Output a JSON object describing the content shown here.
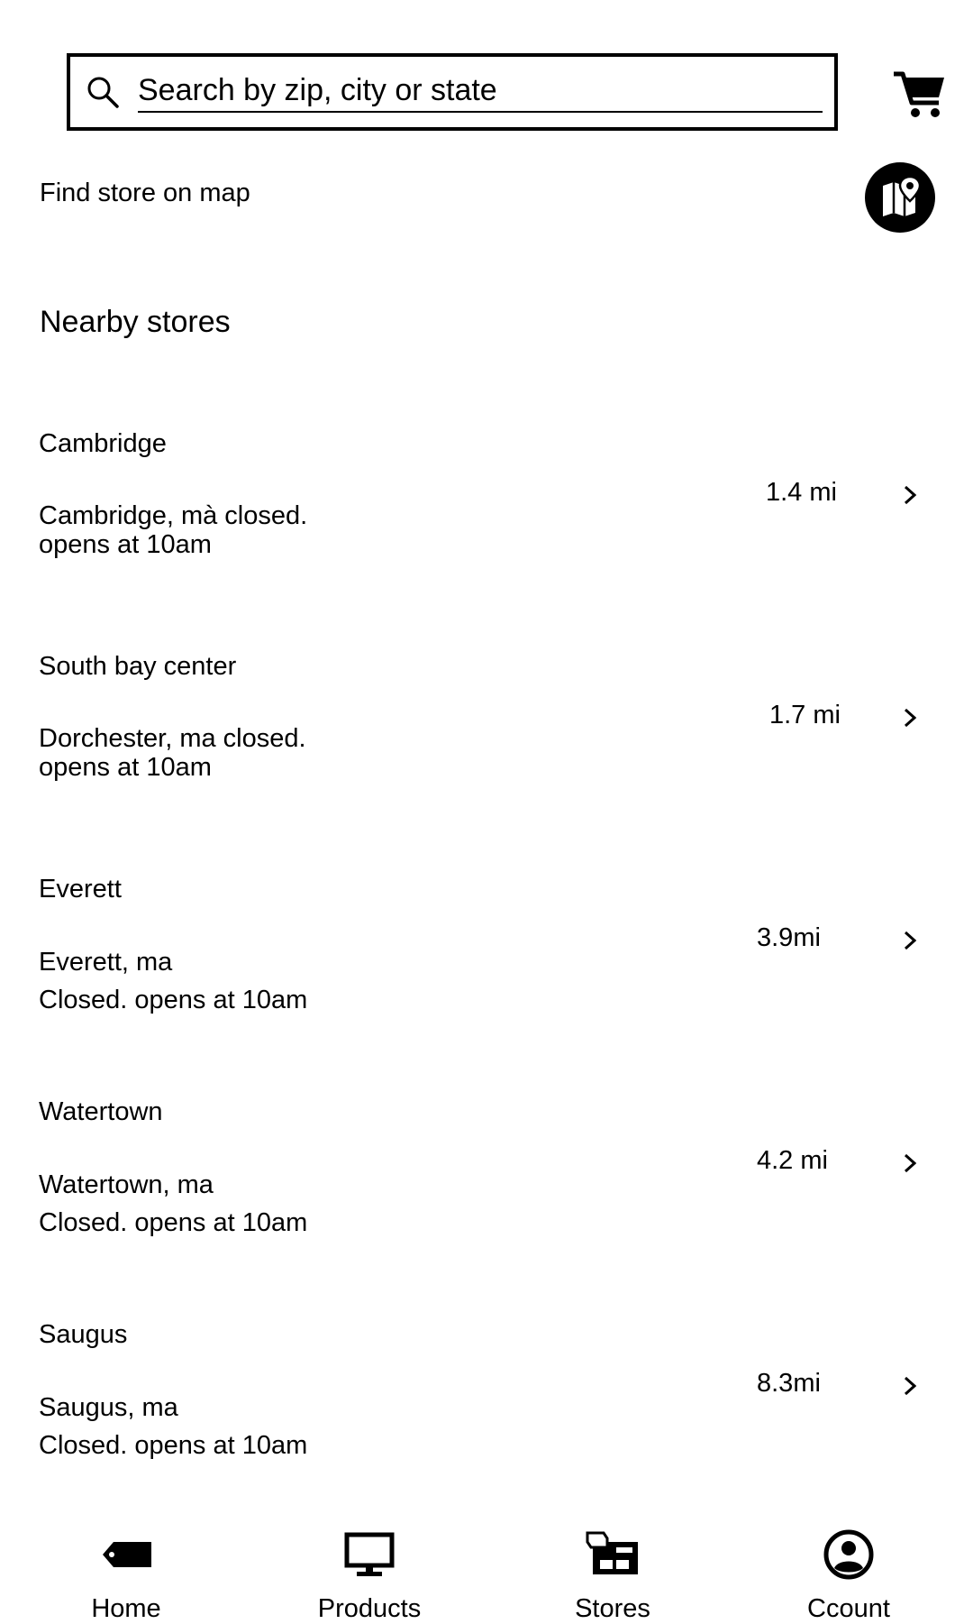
{
  "search": {
    "placeholder": "Search by zip, city or state",
    "icon": "search-icon"
  },
  "header": {
    "cart_icon": "cart-icon"
  },
  "map": {
    "link_label": "Find store on map",
    "button_icon": "map-pin-icon"
  },
  "nearby": {
    "title": "Nearby stores",
    "stores": [
      {
        "name": "Cambridge",
        "line1": "Cambridge, mà closed.",
        "line2": "opens at 10am",
        "distance": "1.4 mi"
      },
      {
        "name": "South bay center",
        "line1": "Dorchester, ma closed.",
        "line2": "opens at 10am",
        "distance": "1.7 mi"
      },
      {
        "name": "Everett",
        "line1": "Everett, ma",
        "line2": "Closed. opens at 10am",
        "distance": "3.9mi"
      },
      {
        "name": "Watertown",
        "line1": "Watertown, ma",
        "line2": "Closed. opens at 10am",
        "distance": "4.2 mi"
      },
      {
        "name": "Saugus",
        "line1": "Saugus, ma",
        "line2": "Closed. opens at 10am",
        "distance": "8.3mi"
      }
    ]
  },
  "nav": {
    "items": [
      {
        "label": "Home",
        "icon": "tag-icon"
      },
      {
        "label": "Products",
        "icon": "monitor-icon"
      },
      {
        "label": "Stores",
        "icon": "store-icon"
      },
      {
        "label": "Ccount",
        "icon": "account-icon"
      }
    ]
  }
}
